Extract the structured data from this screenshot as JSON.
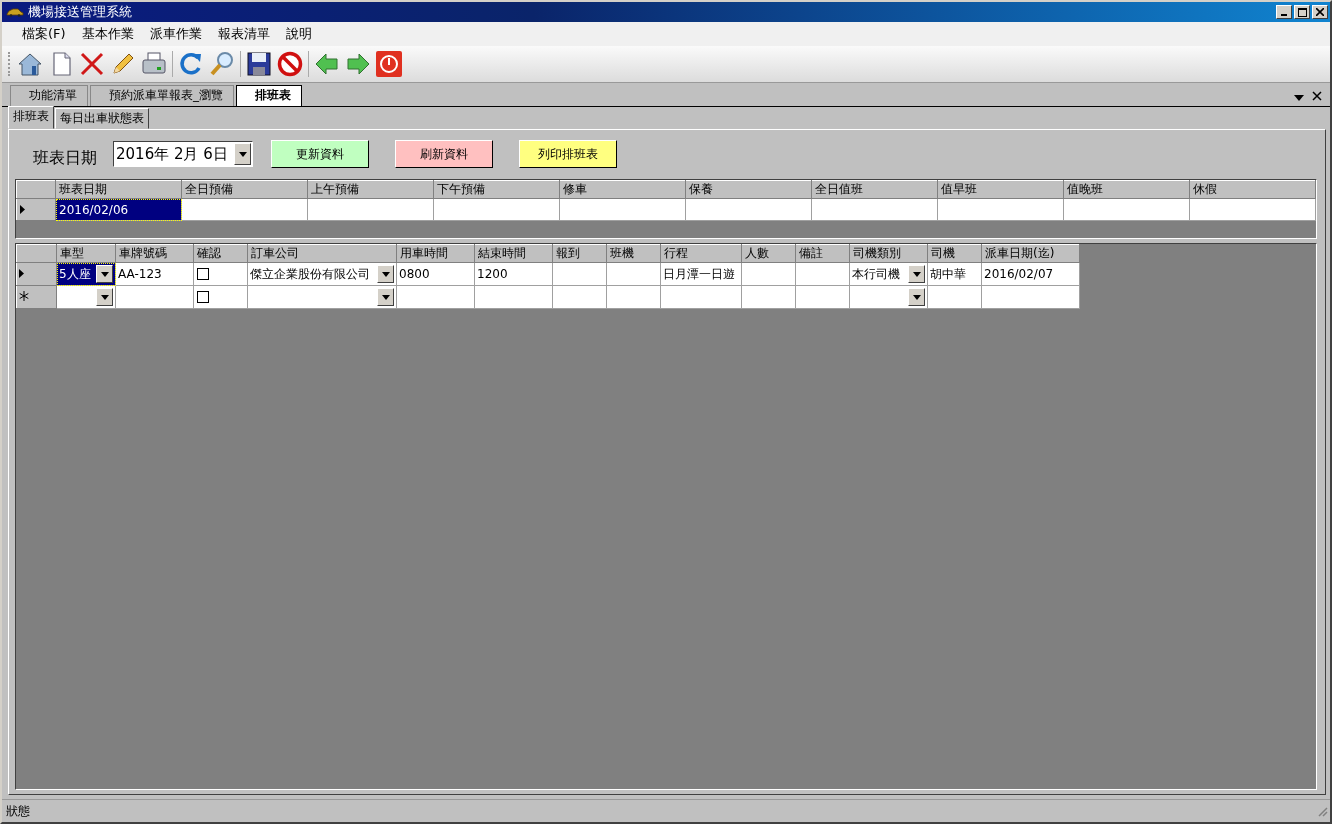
{
  "window": {
    "title": "機場接送管理系統"
  },
  "menu": [
    {
      "label": "檔案(F)"
    },
    {
      "label": "基本作業"
    },
    {
      "label": "派車作業"
    },
    {
      "label": "報表清單"
    },
    {
      "label": "說明"
    }
  ],
  "doc_tabs": [
    {
      "label": "功能清單",
      "selected": false
    },
    {
      "label": "預約派車單報表_瀏覽",
      "selected": false
    },
    {
      "label": "排班表",
      "selected": true
    }
  ],
  "sub_tabs": [
    {
      "label": "排班表",
      "selected": true
    },
    {
      "label": "每日出車狀態表",
      "selected": false
    }
  ],
  "date_field": {
    "label": "班表日期",
    "value": "2016年 2月 6日"
  },
  "buttons": [
    {
      "label": "更新資料",
      "color": "#c0ffc0"
    },
    {
      "label": "刷新資料",
      "color": "#ffc0c0"
    },
    {
      "label": "列印排班表",
      "color": "#ffff80"
    }
  ],
  "schedule_grid": {
    "columns": [
      "班表日期",
      "全日預備",
      "上午預備",
      "下午預備",
      "修車",
      "保養",
      "全日值班",
      "值早班",
      "值晚班",
      "休假"
    ],
    "rows": [
      {
        "current": true,
        "cells": [
          {
            "value": "2016/02/06",
            "selected": true
          },
          {
            "selected": false
          },
          {
            "selected": false
          },
          {
            "selected": false
          },
          {
            "selected": false
          },
          {
            "selected": false
          },
          {
            "selected": false
          },
          {
            "selected": false
          },
          {
            "selected": false
          },
          {
            "selected": false
          }
        ]
      }
    ]
  },
  "dispatch_grid": {
    "columns": [
      {
        "label": "車型",
        "kind": "combo"
      },
      {
        "label": "車牌號碼",
        "kind": "text"
      },
      {
        "label": "確認",
        "kind": "check"
      },
      {
        "label": "訂車公司",
        "kind": "combo"
      },
      {
        "label": "用車時間",
        "kind": "text"
      },
      {
        "label": "結束時間",
        "kind": "text"
      },
      {
        "label": "報到",
        "kind": "text"
      },
      {
        "label": "班機",
        "kind": "text"
      },
      {
        "label": "行程",
        "kind": "text"
      },
      {
        "label": "人數",
        "kind": "text"
      },
      {
        "label": "備註",
        "kind": "text"
      },
      {
        "label": "司機類別",
        "kind": "combo"
      },
      {
        "label": "司機",
        "kind": "text"
      },
      {
        "label": "派車日期(迄)",
        "kind": "text"
      }
    ],
    "rows": [
      {
        "current": true,
        "new_row": false,
        "cells": [
          {
            "value": "5人座",
            "selected": true
          },
          {
            "value": "AA-123",
            "selected": false
          },
          {
            "checked": false,
            "selected": false
          },
          {
            "value": "傑立企業股份有限公司",
            "selected": false
          },
          {
            "value": "0800",
            "selected": false
          },
          {
            "value": "1200",
            "selected": false
          },
          {
            "selected": false
          },
          {
            "selected": false
          },
          {
            "value": "日月潭一日遊",
            "selected": false
          },
          {
            "selected": false
          },
          {
            "selected": false
          },
          {
            "value": "本行司機",
            "selected": false
          },
          {
            "value": "胡中華",
            "selected": false
          },
          {
            "value": "2016/02/07",
            "selected": false
          }
        ]
      },
      {
        "current": false,
        "new_row": true,
        "cells": [
          {
            "selected": false
          },
          {
            "selected": false
          },
          {
            "checked": false,
            "selected": false
          },
          {
            "selected": false
          },
          {
            "selected": false
          },
          {
            "selected": false
          },
          {
            "selected": false
          },
          {
            "selected": false
          },
          {
            "selected": false
          },
          {
            "selected": false
          },
          {
            "selected": false
          },
          {
            "selected": false
          },
          {
            "selected": false
          },
          {
            "selected": false
          }
        ]
      }
    ]
  },
  "status_bar": {
    "text": "狀態"
  }
}
